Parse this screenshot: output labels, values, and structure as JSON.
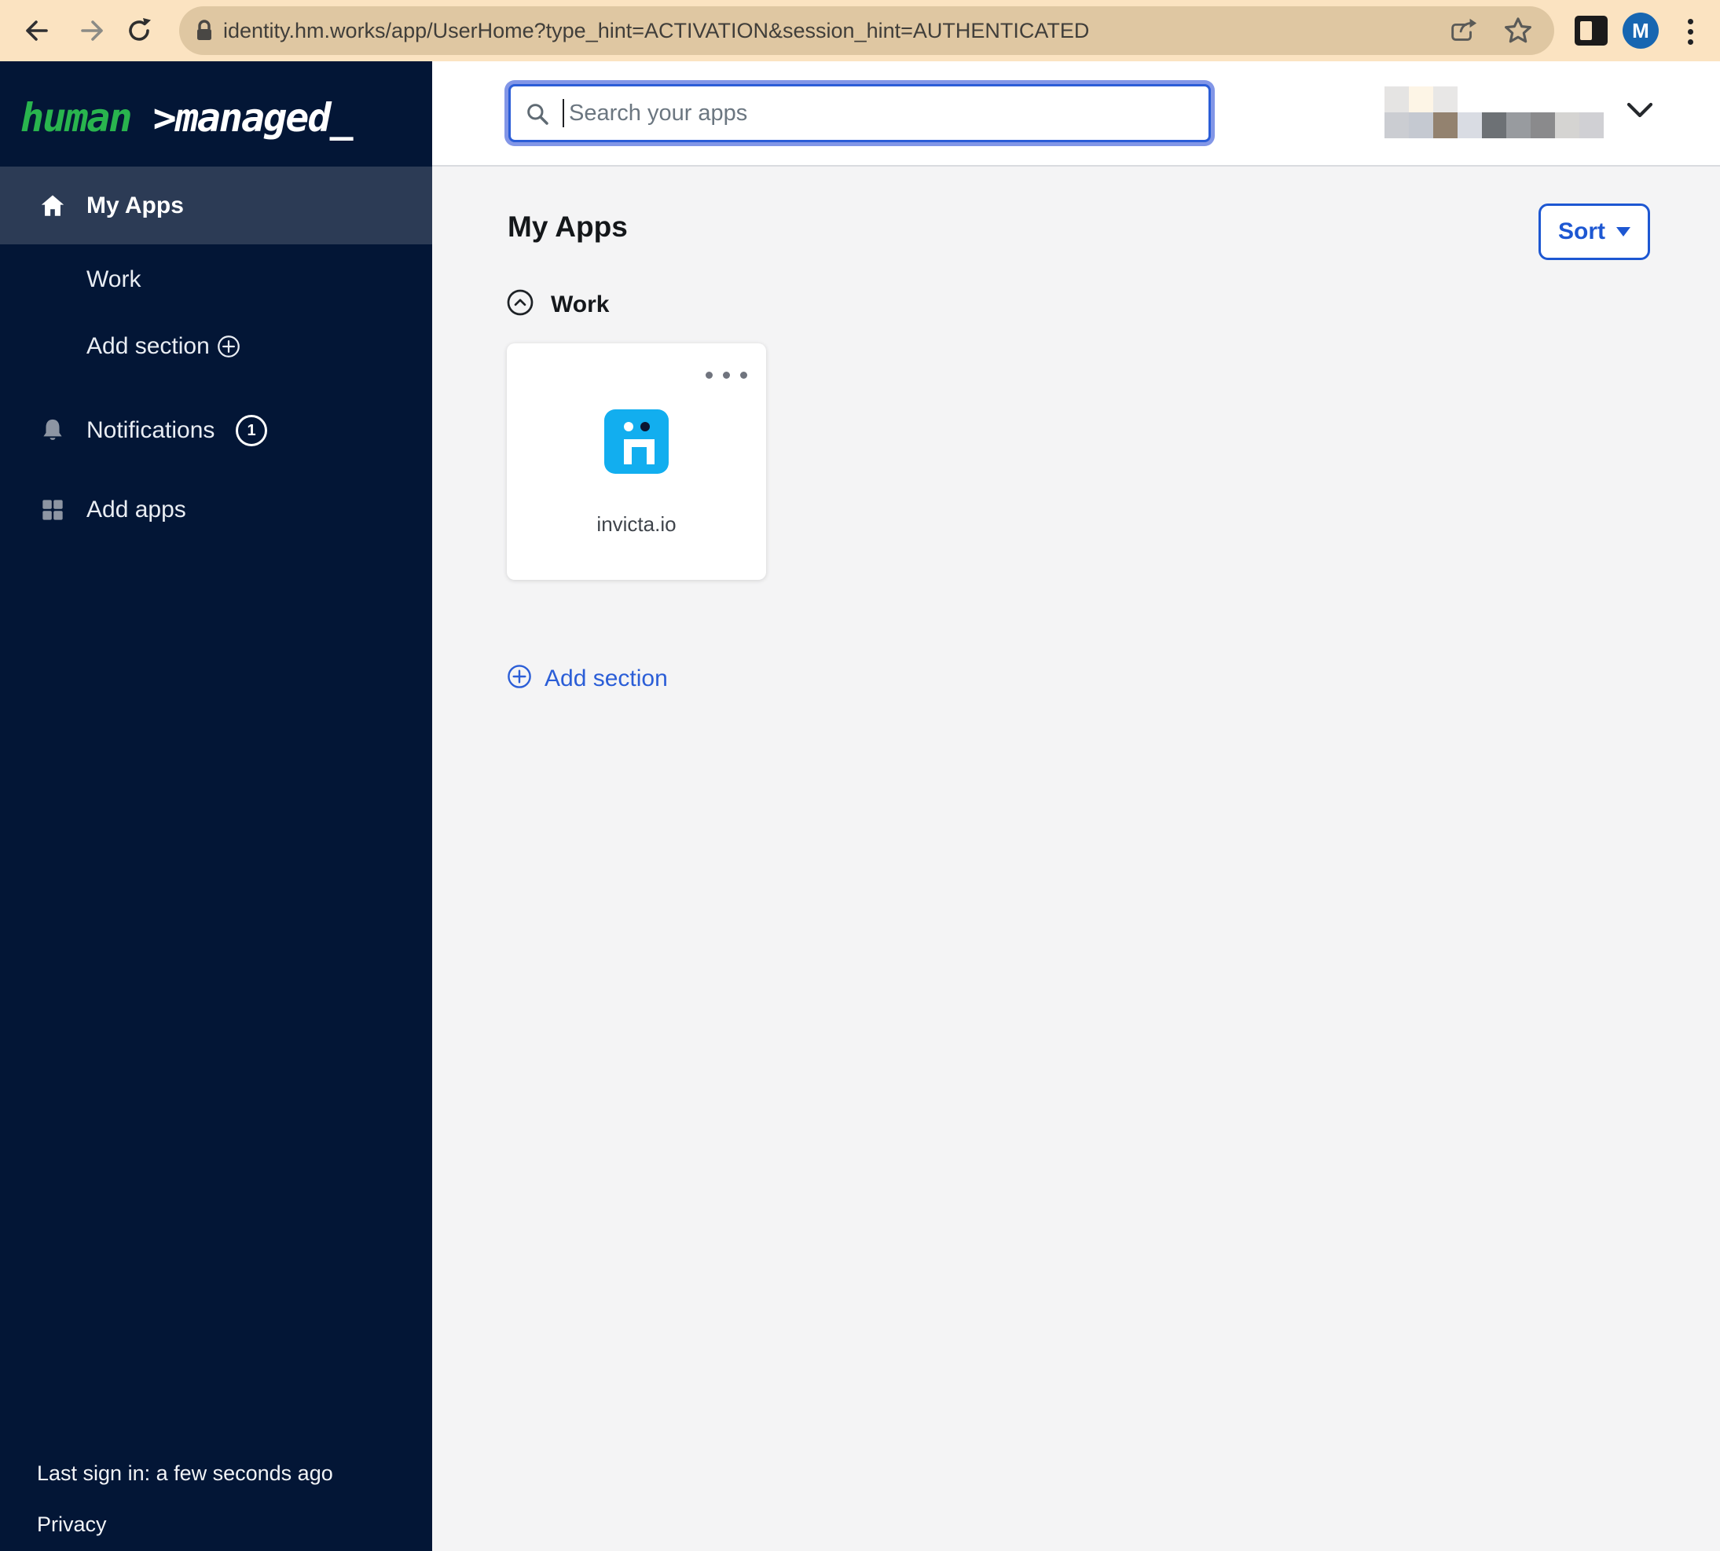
{
  "browser": {
    "url": "identity.hm.works/app/UserHome?type_hint=ACTIVATION&session_hint=AUTHENTICATED",
    "avatar_initial": "M",
    "colors": {
      "bar_bg": "#fbe3c1",
      "pill_bg": "#dfc7a2",
      "avatar_bg": "#1766b1"
    }
  },
  "sidebar": {
    "logo": {
      "part1": "human ",
      "part2": ">managed_",
      "accent_green": "#29b44e"
    },
    "items": [
      {
        "label": "My Apps",
        "icon": "home-icon",
        "active": true
      },
      {
        "label": "Work"
      },
      {
        "label": "Add section",
        "icon": "plus-circle-icon"
      },
      {
        "label": "Notifications",
        "icon": "bell-icon",
        "badge": "1"
      },
      {
        "label": "Add apps",
        "icon": "grid-icon"
      }
    ],
    "footer": {
      "last_sign_in": "Last sign in: a few seconds ago",
      "privacy": "Privacy"
    },
    "colors": {
      "bg": "#031636",
      "active_bg": "#2c3b55"
    }
  },
  "header": {
    "search_placeholder": "Search your apps",
    "user_mosaic": {
      "rows": [
        [
          "#e5e4e3",
          "#fdf5e6",
          "#e8e7e6"
        ],
        [
          "#cbcdd2",
          "#c5c9d1",
          "#93826f",
          "#d9dce3",
          "#6d7175",
          "#989b9f",
          "#8a8a8c",
          "#d5d4d2",
          "#d0d0d4"
        ]
      ]
    }
  },
  "main": {
    "title": "My Apps",
    "sort_label": "Sort",
    "section_label": "Work",
    "apps": [
      {
        "name": "invicta.io",
        "icon_bg": "#12aeef"
      }
    ],
    "add_section_label": "Add section",
    "accent_blue": "#2b5ed7"
  }
}
